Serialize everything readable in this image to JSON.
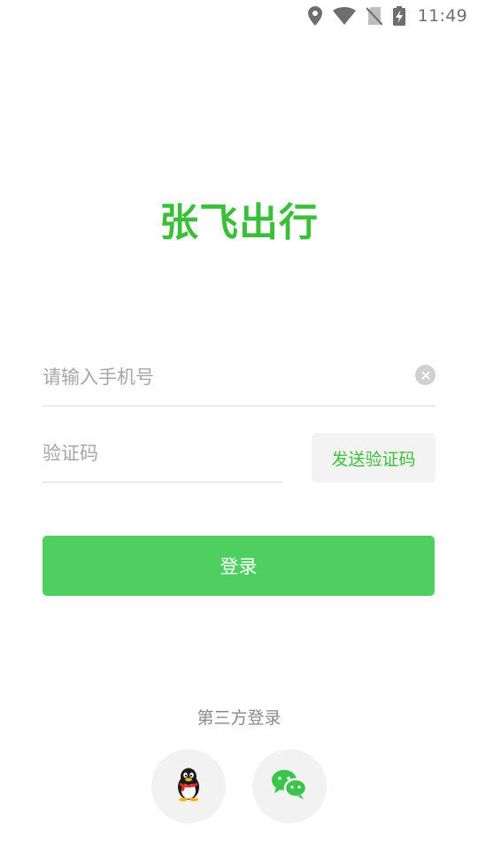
{
  "status_bar": {
    "time": "11:49",
    "icons": [
      "location-icon",
      "wifi-icon",
      "no-sim-icon",
      "battery-charging-icon"
    ]
  },
  "logo": {
    "text": "张飞出行",
    "color": "#3bbf3b"
  },
  "form": {
    "phone_placeholder": "请输入手机号",
    "phone_value": "",
    "code_placeholder": "验证码",
    "code_value": "",
    "send_code_label": "发送验证码",
    "login_label": "登录"
  },
  "third_party": {
    "label": "第三方登录",
    "providers": [
      {
        "name": "QQ",
        "icon": "qq-penguin-icon"
      },
      {
        "name": "WeChat",
        "icon": "wechat-icon"
      }
    ]
  },
  "colors": {
    "accent": "#4ecf60",
    "accent_text": "#3bbf3b",
    "placeholder": "#a6a6a6",
    "divider": "#dcdcdc"
  }
}
